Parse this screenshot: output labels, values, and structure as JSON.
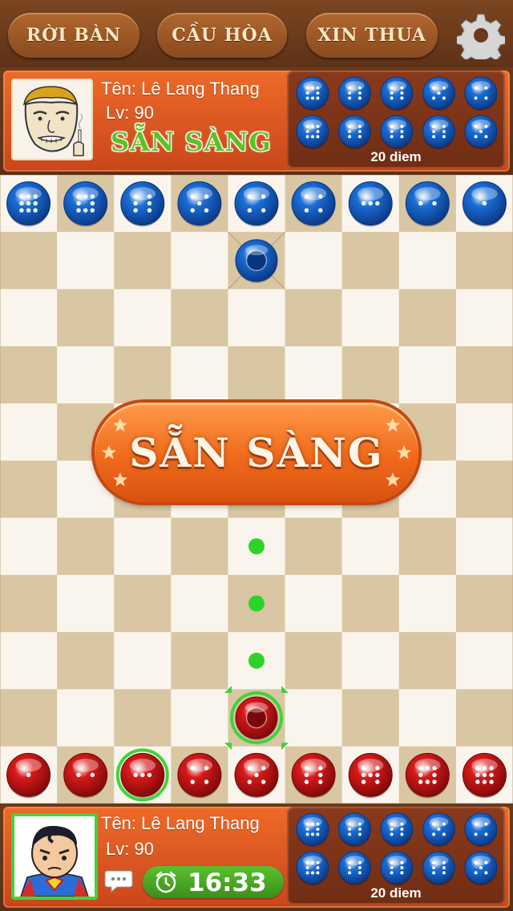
{
  "top_bar": {
    "leave_label": "RỜI BÀN",
    "draw_label": "CẦU HÒA",
    "resign_label": "XIN THUA"
  },
  "opponent": {
    "name_label": "Tên: Lê Lang Thang",
    "level_label": "Lv: 90",
    "status": "SẴN SÀNG",
    "captured_pips": [
      8,
      6,
      6,
      5,
      4,
      8,
      6,
      6,
      6,
      5
    ],
    "score_label": "20 diem"
  },
  "player": {
    "name_label": "Tên: Lê Lang Thang",
    "level_label": "Lv: 90",
    "timer": "16:33",
    "captured_pips": [
      8,
      6,
      6,
      5,
      4,
      8,
      6,
      6,
      6,
      5
    ],
    "score_label": "20 diem"
  },
  "board": {
    "columns": 9,
    "rows": 11,
    "blue_home_row_pips": [
      9,
      8,
      6,
      5,
      4,
      4,
      3,
      2,
      1
    ],
    "red_home_row_pips": [
      1,
      2,
      3,
      4,
      5,
      6,
      7,
      8,
      9
    ],
    "blue_piece": {
      "col": 4,
      "row": 1
    },
    "red_selected_piece": {
      "col": 4,
      "row": 9
    },
    "highlighted_red_home_col": 2,
    "move_hints": [
      {
        "col": 4,
        "row": 6
      },
      {
        "col": 4,
        "row": 7
      },
      {
        "col": 4,
        "row": 8
      }
    ]
  },
  "banner": {
    "text": "SẴN SÀNG"
  },
  "colors": {
    "blue_piece": "#1a6fd8",
    "red_piece": "#d81a1a",
    "hint": "#2ed32a",
    "panel_orange": "#e05a22"
  }
}
